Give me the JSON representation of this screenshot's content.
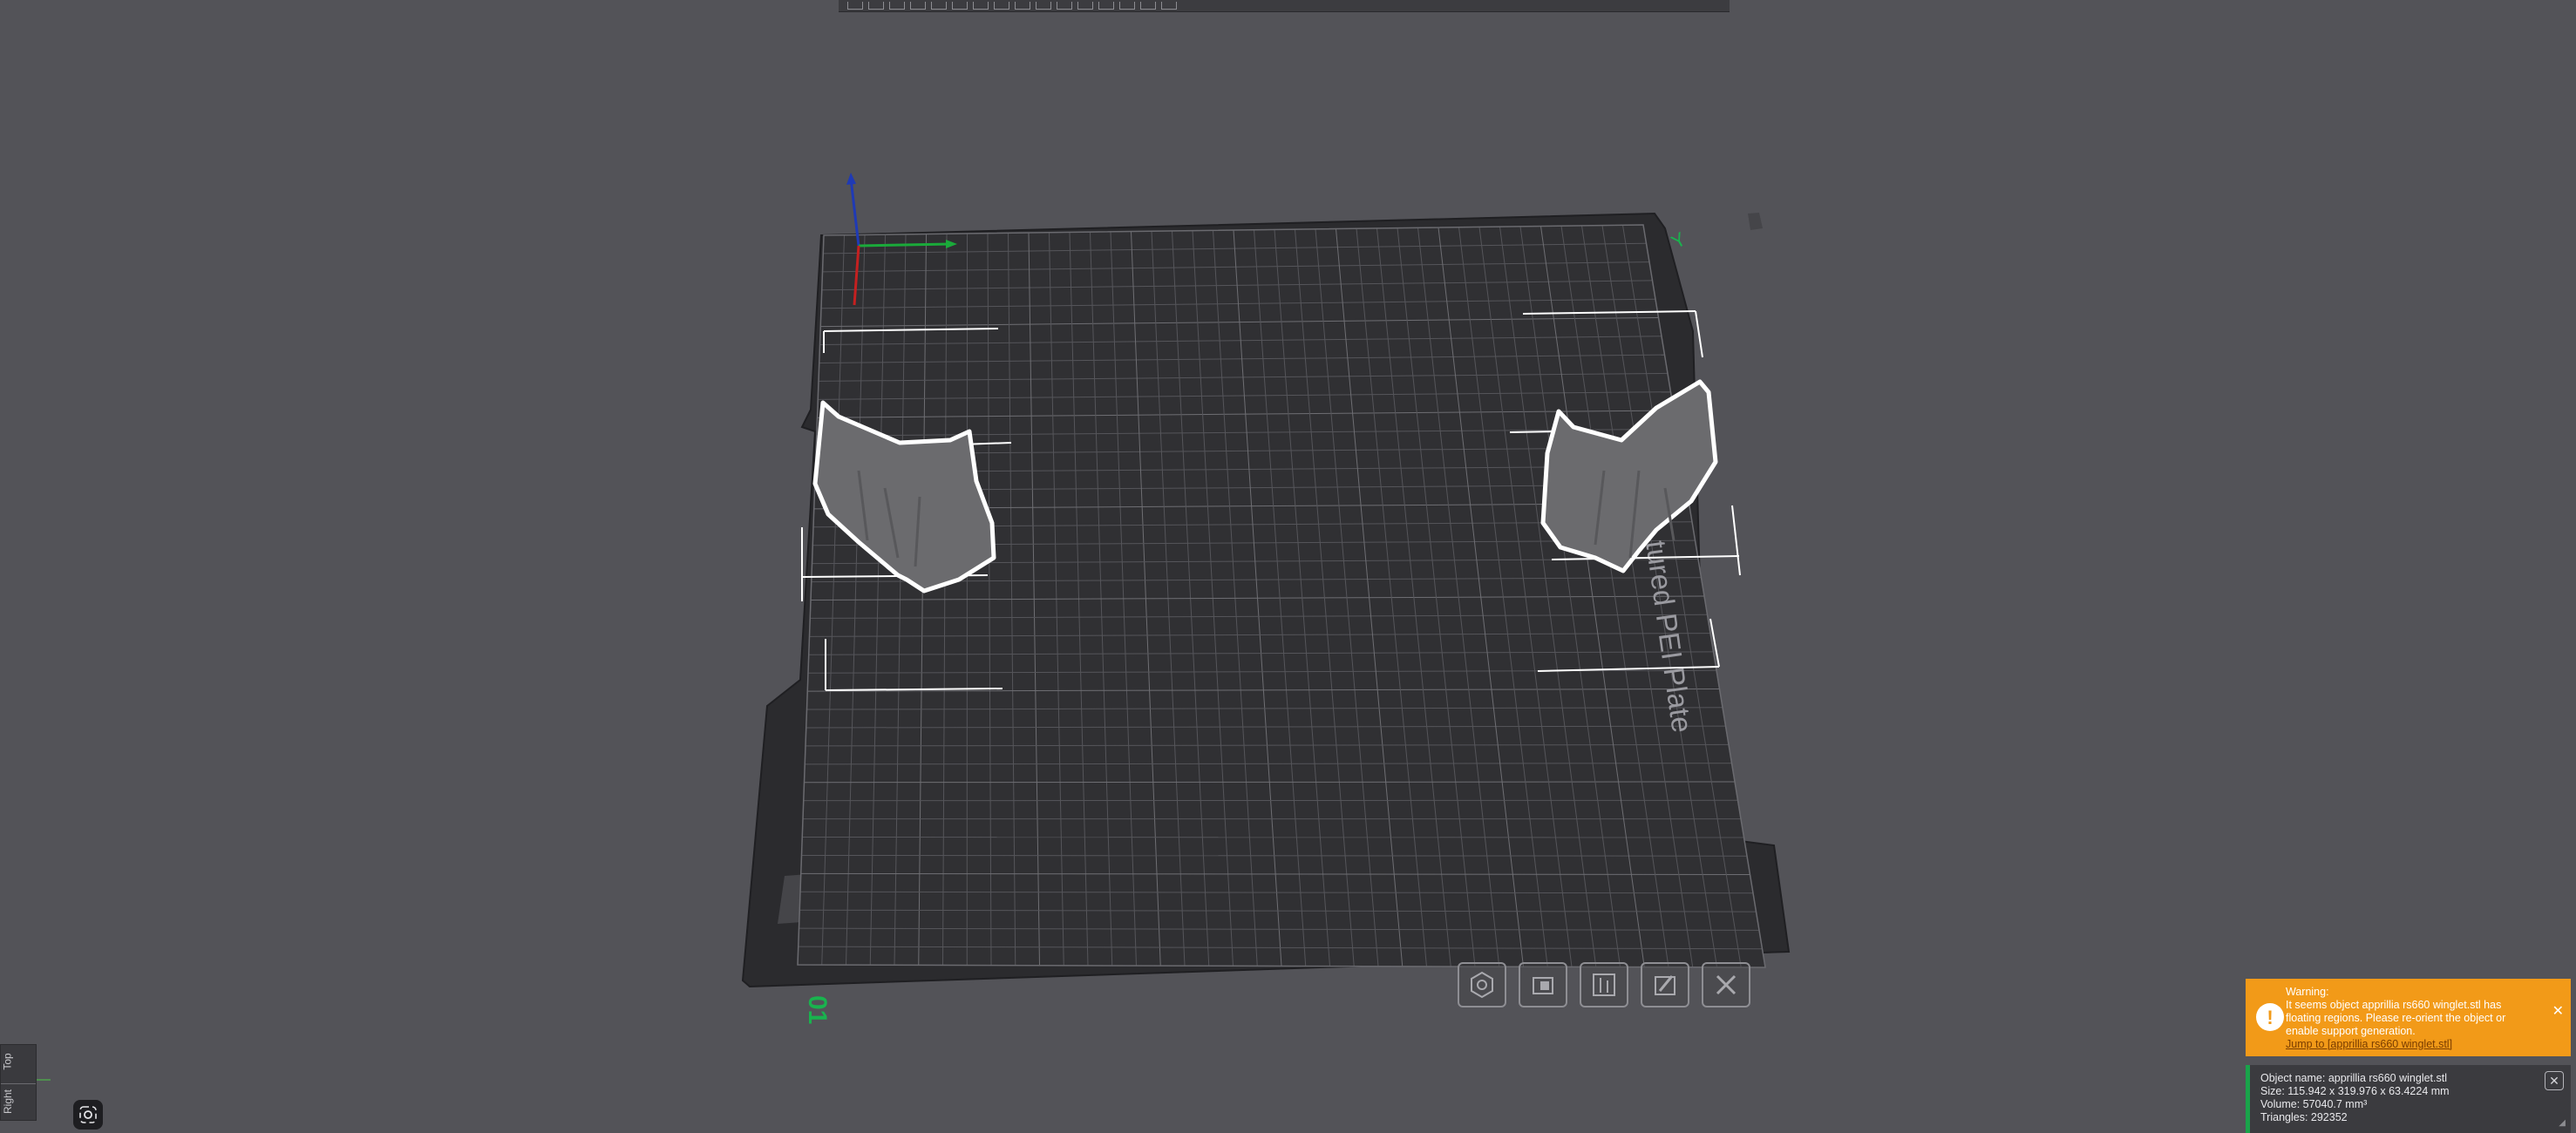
{
  "plate": {
    "number_label": "01",
    "y_axis_label": "Y",
    "plate_text": "tured PEI Plate"
  },
  "top_toolbar": {
    "icons": [
      "add-icon",
      "add-plate-icon",
      "arrange-icon",
      "orient-icon",
      "layers-icon",
      "move-icon",
      "rotate-icon",
      "scale-icon",
      "cut-icon",
      "support-paint-icon",
      "seam-paint-icon",
      "text-icon",
      "split-icon",
      "assembly-icon",
      "measure-icon",
      "view-icon"
    ]
  },
  "plate_toolbar": {
    "icons": [
      "gear-icon",
      "orient-plate-icon",
      "arrange-plate-icon",
      "settings-plate-icon",
      "close-plate-icon"
    ]
  },
  "view_cube": {
    "top_label": "Top",
    "front_label": "Right"
  },
  "warning": {
    "title": "Warning:",
    "message": "It seems object apprillia rs660 winglet.stl has floating regions. Please re-orient the object or enable support generation.",
    "link": "Jump to [apprillia rs660 winglet.stl]",
    "icon": "exclamation-icon",
    "close_icon": "close-icon",
    "color": "#f29a18"
  },
  "object_info": {
    "name": "Object name: apprillia rs660 winglet.stl",
    "size": "Size: 115.942 x 319.976 x 63.4224 mm",
    "volume": "Volume: 57040.7 mm³",
    "triangles": "Triangles: 292352",
    "accent": "#19a34a"
  }
}
